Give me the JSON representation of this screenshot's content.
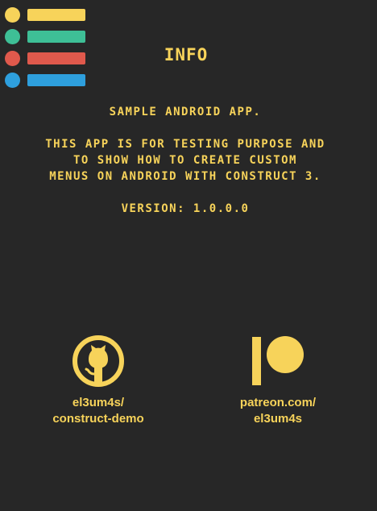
{
  "menu": {
    "items": [
      {
        "color": "#f7d35a"
      },
      {
        "color": "#3ebf96"
      },
      {
        "color": "#e0594c"
      },
      {
        "color": "#2e9fdd"
      }
    ]
  },
  "header": {
    "title": "Info"
  },
  "info": {
    "line1": "Sample Android App.",
    "line2": "This app is for testing purpose and",
    "line3": "to show how to create custom",
    "line4": "menus on Android with Construct 3.",
    "version": "Version: 1.0.0.0"
  },
  "links": {
    "github": {
      "icon": "github-icon",
      "line1": "el3um4s/",
      "line2": "construct-demo"
    },
    "patreon": {
      "icon": "patreon-icon",
      "line1": "patreon.com/",
      "line2": "el3um4s"
    }
  },
  "colors": {
    "accent": "#f7d35a",
    "background": "#272727"
  }
}
